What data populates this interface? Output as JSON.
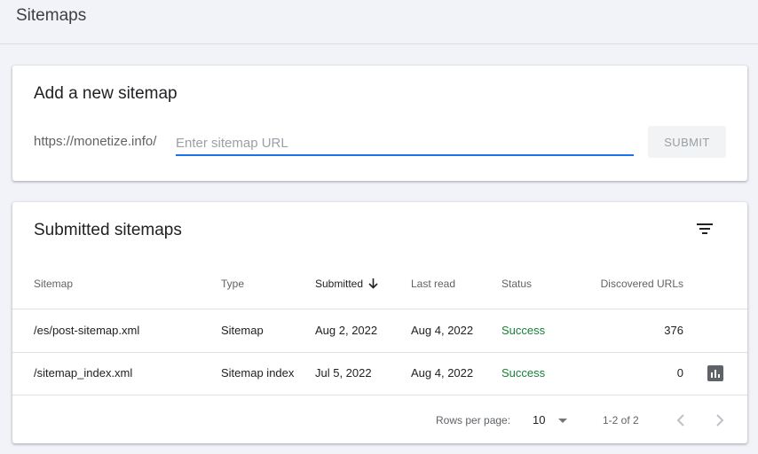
{
  "page": {
    "title": "Sitemaps"
  },
  "add": {
    "title": "Add a new sitemap",
    "prefix": "https://monetize.info/",
    "placeholder": "Enter sitemap URL",
    "value": "",
    "submit_label": "SUBMIT"
  },
  "submitted": {
    "title": "Submitted sitemaps",
    "columns": [
      "Sitemap",
      "Type",
      "Submitted",
      "Last read",
      "Status",
      "Discovered URLs"
    ],
    "rows": [
      {
        "sitemap": "/es/post-sitemap.xml",
        "type": "Sitemap",
        "submitted": "Aug 2, 2022",
        "last_read": "Aug 4, 2022",
        "status": "Success",
        "urls": "376"
      },
      {
        "sitemap": "/sitemap_index.xml",
        "type": "Sitemap index",
        "submitted": "Jul 5, 2022",
        "last_read": "Aug 4, 2022",
        "status": "Success",
        "urls": "0"
      }
    ],
    "footer": {
      "rows_per_page_label": "Rows per page:",
      "rows_per_page": "10",
      "range": "1-2 of 2"
    }
  },
  "colors": {
    "accent": "#1a73e8",
    "success": "#188038",
    "background": "#f1f3f9"
  },
  "icons": {
    "filter": "filter-icon",
    "sort": "arrow-down-icon",
    "chart": "bar-chart-icon",
    "prev": "chevron-left-icon",
    "next": "chevron-right-icon",
    "dropdown": "caret-down-icon"
  }
}
